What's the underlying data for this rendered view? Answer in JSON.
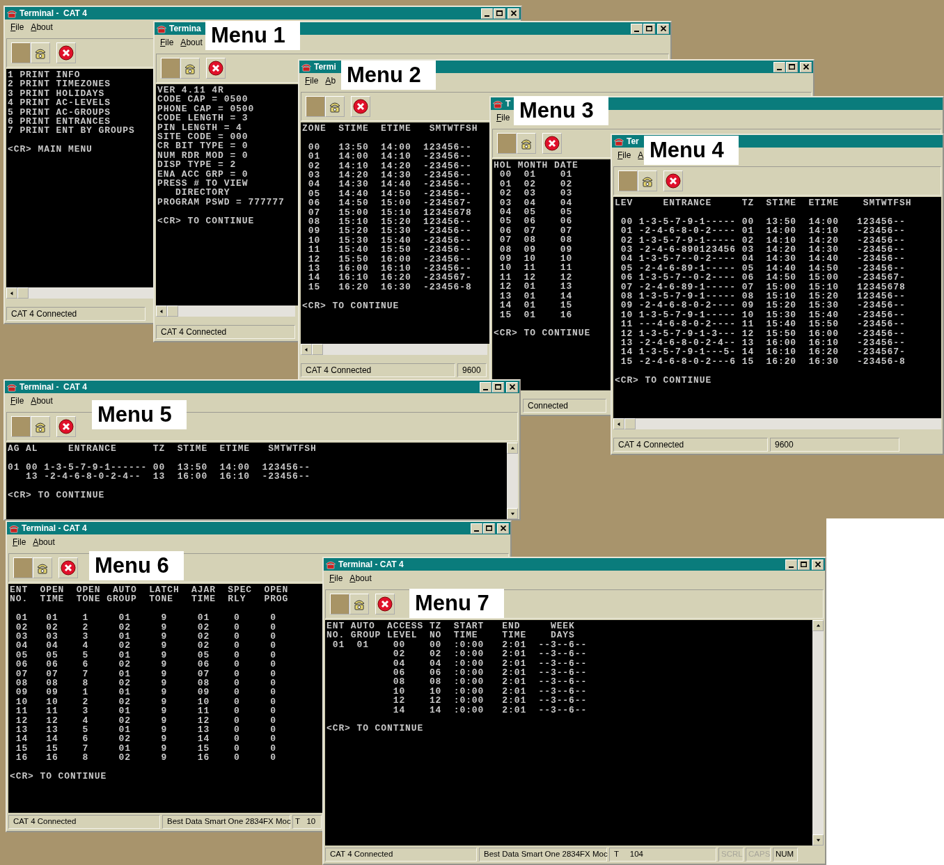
{
  "windows": [
    {
      "title": "Terminal -  CAT 4",
      "window_controls": true,
      "menu": [
        "File",
        "About"
      ],
      "horizontal_scrollbar": true,
      "screen": [
        {
          "text": "1 PRINT INFO"
        },
        {
          "text": "2 PRINT TIMEZONES"
        },
        {
          "text": "3 PRINT HOLIDAYS"
        },
        {
          "text": "4 PRINT AC-LEVELS"
        },
        {
          "text": "5 PRINT AC-GROUPS"
        },
        {
          "text": "6 PRINT ENTRANCES"
        },
        {
          "text": "7 PRINT ENT BY GROUPS"
        },
        {
          "text": "<CR> MAIN MENU",
          "blank_before": true
        }
      ],
      "status": [
        {
          "text": "CAT 4 Connected",
          "kind": "field"
        }
      ]
    },
    {
      "title": "Termina",
      "window_controls": true,
      "menu": [
        "File",
        "About"
      ],
      "horizontal_scrollbar": true,
      "screen": [
        {
          "text": "VER 4.11 4R"
        },
        {
          "text": "CODE CAP = 0500"
        },
        {
          "text": "PHONE CAP = 0500"
        },
        {
          "text": "CODE LENGTH = 3"
        },
        {
          "text": "PIN LENGTH = 4"
        },
        {
          "text": "SITE CODE = 000"
        },
        {
          "text": "CR BIT TYPE = 0"
        },
        {
          "text": "NUM RDR MOD = 0"
        },
        {
          "text": "DISP TYPE = 2"
        },
        {
          "text": "ENA ACC GRP = 0"
        },
        {
          "text": "PRESS # TO VIEW"
        },
        {
          "text": "   DIRECTORY"
        },
        {
          "text": "PROGRAM PSWD = 777777"
        },
        {
          "text": "<CR> TO CONTINUE",
          "blank_before": true
        }
      ],
      "status": [
        {
          "text": "CAT 4 Connected",
          "kind": "field"
        }
      ]
    },
    {
      "title": "Termi",
      "window_controls": true,
      "menu": [
        "File",
        "Ab"
      ],
      "horizontal_scrollbar": true,
      "screen": [
        {
          "text": "ZONE  STIME  ETIME   SMTWTFSH"
        },
        {
          "text": " 00   13:50  14:00  123456--",
          "blank_before": true
        },
        {
          "text": " 01   14:00  14:10  -23456--"
        },
        {
          "text": " 02   14:10  14:20  -23456--"
        },
        {
          "text": " 03   14:20  14:30  -23456--"
        },
        {
          "text": " 04   14:30  14:40  -23456--"
        },
        {
          "text": " 05   14:40  14:50  -23456--"
        },
        {
          "text": " 06   14:50  15:00  -234567-"
        },
        {
          "text": " 07   15:00  15:10  12345678"
        },
        {
          "text": " 08   15:10  15:20  123456--"
        },
        {
          "text": " 09   15:20  15:30  -23456--"
        },
        {
          "text": " 10   15:30  15:40  -23456--"
        },
        {
          "text": " 11   15:40  15:50  -23456--"
        },
        {
          "text": " 12   15:50  16:00  -23456--"
        },
        {
          "text": " 13   16:00  16:10  -23456--"
        },
        {
          "text": " 14   16:10  16:20  -234567-"
        },
        {
          "text": " 15   16:20  16:30  -23456-8"
        },
        {
          "text": "<CR> TO CONTINUE",
          "blank_before": true
        }
      ],
      "status": [
        {
          "text": "CAT 4 Connected",
          "kind": "field"
        },
        {
          "text": "9600",
          "kind": "field"
        }
      ]
    },
    {
      "title": "T",
      "menu": [
        "File"
      ],
      "screen": [
        {
          "text": "HOL MONTH DATE"
        },
        {
          "text": " 00  01    01"
        },
        {
          "text": " 01  02    02"
        },
        {
          "text": " 02  03    03"
        },
        {
          "text": " 03  04    04"
        },
        {
          "text": " 04  05    05"
        },
        {
          "text": " 05  06    06"
        },
        {
          "text": " 06  07    07"
        },
        {
          "text": " 07  08    08"
        },
        {
          "text": " 08  09    09"
        },
        {
          "text": " 09  10    10"
        },
        {
          "text": " 10  11    11"
        },
        {
          "text": " 11  12    12"
        },
        {
          "text": " 12  01    13"
        },
        {
          "text": " 13  01    14"
        },
        {
          "text": " 14  01    15"
        },
        {
          "text": " 15  01    16"
        },
        {
          "text": "<CR> TO CONTINUE",
          "blank_before": true
        }
      ],
      "status": [
        {
          "text": "Connected",
          "kind": "field"
        }
      ]
    },
    {
      "title": "Ter",
      "menu": [
        "File",
        "A"
      ],
      "horizontal_scrollbar": true,
      "screen": [
        {
          "text": "LEV     ENTRANCE     TZ  STIME  ETIME    SMTWTFSH"
        },
        {
          "text": " 00 1-3-5-7-9-1----- 00  13:50  14:00   123456--",
          "blank_before": true
        },
        {
          "text": " 01 -2-4-6-8-0-2---- 01  14:00  14:10   -23456--"
        },
        {
          "text": " 02 1-3-5-7-9-1----- 02  14:10  14:20   -23456--"
        },
        {
          "text": " 03 -2-4-6-890123456 03  14:20  14:30   -23456--"
        },
        {
          "text": " 04 1-3-5-7--0-2---- 04  14:30  14:40   -23456--"
        },
        {
          "text": " 05 -2-4-6-89-1----- 05  14:40  14:50   -23456--"
        },
        {
          "text": " 06 1-3-5-7--0-2---- 06  14:50  15:00   -234567-"
        },
        {
          "text": " 07 -2-4-6-89-1----- 07  15:00  15:10   12345678"
        },
        {
          "text": " 08 1-3-5-7-9-1----- 08  15:10  15:20   123456--"
        },
        {
          "text": " 09 -2-4-6-8-0-2---- 09  15:20  15:30   -23456--"
        },
        {
          "text": " 10 1-3-5-7-9-1----- 10  15:30  15:40   -23456--"
        },
        {
          "text": " 11 ---4-6-8-0-2---- 11  15:40  15:50   -23456--"
        },
        {
          "text": " 12 1-3-5-7-9-1-3--- 12  15:50  16:00   -23456--"
        },
        {
          "text": " 13 -2-4-6-8-0-2-4-- 13  16:00  16:10   -23456--"
        },
        {
          "text": " 14 1-3-5-7-9-1---5- 14  16:10  16:20   -234567-"
        },
        {
          "text": " 15 -2-4-6-8-0-2---6 15  16:20  16:30   -23456-8"
        },
        {
          "text": "<CR> TO CONTINUE",
          "blank_before": true
        }
      ],
      "status": [
        {
          "text": "CAT 4 Connected",
          "kind": "field"
        },
        {
          "text": "9600",
          "kind": "field"
        }
      ]
    },
    {
      "title": "Terminal -  CAT 4",
      "window_controls": true,
      "menu": [
        "File",
        "About"
      ],
      "vertical_scrollbar": true,
      "screen": [
        {
          "text": "AG AL     ENTRANCE      TZ  STIME  ETIME   SMTWTFSH"
        },
        {
          "text": "01 00 1-3-5-7-9-1------ 00  13:50  14:00  123456--",
          "blank_before": true
        },
        {
          "text": "   13 -2-4-6-8-0-2-4--  13  16:00  16:10  -23456--"
        },
        {
          "text": "<CR> TO CONTINUE",
          "blank_before": true
        }
      ]
    },
    {
      "title": "Terminal - CAT 4",
      "window_controls": true,
      "menu": [
        "File",
        "About"
      ],
      "screen": [
        {
          "text": "ENT  OPEN  OPEN  AUTO  LATCH  AJAR  SPEC  OPEN"
        },
        {
          "text": "NO.  TIME  TONE GROUP  TONE   TIME  RLY   PROG"
        },
        {
          "text": " 01   01    1     01     9     01    0     0",
          "blank_before": true
        },
        {
          "text": " 02   02    2     02     9     02    0     0"
        },
        {
          "text": " 03   03    3     01     9     02    0     0"
        },
        {
          "text": " 04   04    4     02     9     02    0     0"
        },
        {
          "text": " 05   05    5     01     9     05    0     0"
        },
        {
          "text": " 06   06    6     02     9     06    0     0"
        },
        {
          "text": " 07   07    7     01     9     07    0     0"
        },
        {
          "text": " 08   08    8     02     9     08    0     0"
        },
        {
          "text": " 09   09    1     01     9     09    0     0"
        },
        {
          "text": " 10   10    2     02     9     10    0     0"
        },
        {
          "text": " 11   11    3     01     9     11    0     0"
        },
        {
          "text": " 12   12    4     02     9     12    0     0"
        },
        {
          "text": " 13   13    5     01     9     13    0     0"
        },
        {
          "text": " 14   14    6     02     9     14    0     0"
        },
        {
          "text": " 15   15    7     01     9     15    0     0"
        },
        {
          "text": " 16   16    8     02     9     16    0     0"
        },
        {
          "text": "<CR> TO CONTINUE",
          "blank_before": true
        }
      ],
      "status": [
        {
          "text": "CAT 4 Connected",
          "kind": "field"
        },
        {
          "text": "Best Data Smart One 2834FX Moc",
          "kind": "field"
        },
        {
          "text": "T   10",
          "kind": "field"
        }
      ]
    },
    {
      "title": "Terminal - CAT 4",
      "window_controls": true,
      "menu": [
        "File",
        "About"
      ],
      "vertical_scrollbar": true,
      "screen": [
        {
          "text": "ENT AUTO  ACCESS TZ  START   END     WEEK"
        },
        {
          "text": "NO. GROUP LEVEL  NO  TIME    TIME    DAYS"
        },
        {
          "text": " 01  01    00    00  :0:00   2:01  --3--6--"
        },
        {
          "text": "           02    02  :0:00   2:01  --3--6--"
        },
        {
          "text": "           04    04  :0:00   2:01  --3--6--"
        },
        {
          "text": "           06    06  :0:00   2:01  --3--6--"
        },
        {
          "text": "           08    08  :0:00   2:01  --3--6--"
        },
        {
          "text": "           10    10  :0:00   2:01  --3--6--"
        },
        {
          "text": "           12    12  :0:00   2:01  --3--6--"
        },
        {
          "text": "           14    14  :0:00   2:01  --3--6--"
        },
        {
          "text": "<CR> TO CONTINUE",
          "blank_before": true
        }
      ],
      "status": [
        {
          "text": "CAT 4 Connected",
          "kind": "field"
        },
        {
          "text": "Best Data Smart One 2834FX Moc",
          "kind": "field"
        },
        {
          "text": "T     104",
          "kind": "field"
        },
        {
          "text": "SCRL",
          "kind": "indicator",
          "on": false
        },
        {
          "text": "CAPS",
          "kind": "indicator",
          "on": false
        },
        {
          "text": "NUM",
          "kind": "indicator",
          "on": true
        }
      ]
    }
  ],
  "callouts": [
    "Menu 1",
    "Menu 2",
    "Menu 3",
    "Menu 4",
    "Menu 5",
    "Menu 6",
    "Menu 7"
  ]
}
